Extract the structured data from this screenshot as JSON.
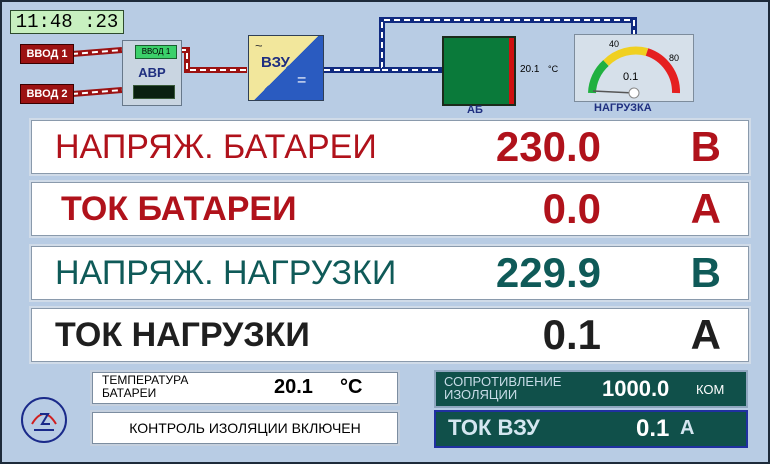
{
  "clock": "11:48 :23",
  "top_diagram": {
    "vvod1": "ВВОД 1",
    "vvod2": "ВВОД 2",
    "avr_indicator": "ВВОД 1",
    "avr_label": "АВР",
    "vzu_label": "ВЗУ",
    "ab_label": "АБ",
    "ab_temp_value": "20.1",
    "ab_temp_unit": "°C",
    "gauge_min_label": "40",
    "gauge_max_label": "80",
    "gauge_value": "0.1",
    "gauge_label": "НАГРУЗКА"
  },
  "rows": [
    {
      "label": "НАПРЯЖ. БАТАРЕИ",
      "value": "230.0",
      "unit": "В",
      "color": "#b0121b"
    },
    {
      "label": "ТОК БАТАРЕИ",
      "value": "0.0",
      "unit": "А",
      "color": "#b0121b"
    },
    {
      "label": "НАПРЯЖ. НАГРУЗКИ",
      "value": "229.9",
      "unit": "В",
      "color": "#0f5a58"
    },
    {
      "label": "ТОК НАГРУЗКИ",
      "value": "0.1",
      "unit": "А",
      "color": "#1f1f1f"
    }
  ],
  "bottom": {
    "temp_label_line1": "ТЕМПЕРАТУРА",
    "temp_label_line2": "БАТАРЕИ",
    "temp_value": "20.1",
    "temp_unit": "°C",
    "isolation_status": "КОНТРОЛЬ ИЗОЛЯЦИИ ВКЛЮЧЕН",
    "resistance_label_line1": "СОПРОТИВЛЕНИЕ",
    "resistance_label_line2": "ИЗОЛЯЦИИ",
    "resistance_value": "1000.0",
    "resistance_unit": "КОМ",
    "charger_current_label": "ТОК ВЗУ",
    "charger_current_value": "0.1",
    "charger_current_unit": "А"
  },
  "icons": {
    "logo": "company-logo"
  }
}
